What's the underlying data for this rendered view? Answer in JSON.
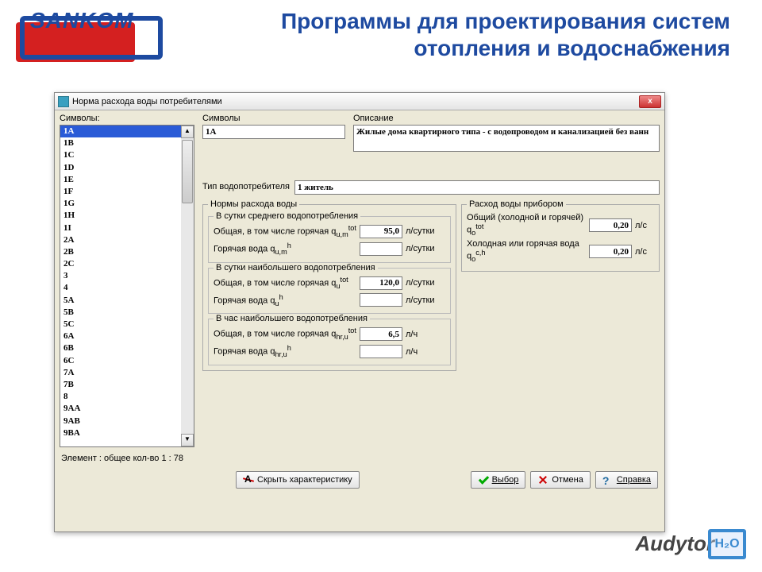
{
  "header": {
    "logo_text": "SANKOM",
    "title": "Программы для проектирования систем отопления и водоснабжения"
  },
  "dialog": {
    "title": "Норма расхода воды потребителями",
    "close": "x",
    "labels": {
      "symbols_left": "Символы:",
      "symbols_right": "Символы",
      "description": "Описание",
      "consumer_type": "Тип водопотребителя"
    },
    "list": {
      "items": [
        "1A",
        "1B",
        "1C",
        "1D",
        "1E",
        "1F",
        "1G",
        "1H",
        "1I",
        "2A",
        "2B",
        "2C",
        "3",
        "4",
        "5A",
        "5B",
        "5C",
        "6A",
        "6B",
        "6C",
        "7A",
        "7B",
        "8",
        "9AA",
        "9AB",
        "9BA"
      ],
      "selected": "1A"
    },
    "symbol_value": "1A",
    "description_value": "Жилые дома квартирного типа - с водопроводом и канализацией без ванн",
    "consumer_type_value": "1 житель",
    "group_norms": {
      "legend": "Нормы расхода воды",
      "avg": {
        "legend": "В сутки среднего водопотребления",
        "total_label": "Общая, в том числе горячая q",
        "total_sub": "u,m",
        "total_sup": "tot",
        "total_value": "95,0",
        "hot_label": "Горячая вода q",
        "hot_sub": "u,m",
        "hot_sup": "h",
        "hot_value": "",
        "unit": "л/сутки"
      },
      "max_day": {
        "legend": "В сутки наибольшего водопотребления",
        "total_label": "Общая, в том числе горячая q",
        "total_sub": "u",
        "total_sup": "tot",
        "total_value": "120,0",
        "hot_label": "Горячая вода q",
        "hot_sub": "u",
        "hot_sup": "h",
        "hot_value": "",
        "unit": "л/сутки"
      },
      "max_hour": {
        "legend": "В час наибольшего водопотребления",
        "total_label": "Общая, в том числе горячая q",
        "total_sub": "hr,u",
        "total_sup": "tot",
        "total_value": "6,5",
        "hot_label": "Горячая вода q",
        "hot_sub": "hr,u",
        "hot_sup": "h",
        "hot_value": "",
        "unit": "л/ч"
      }
    },
    "group_device": {
      "legend": "Расход воды прибором",
      "total_label": "Общий (холодной и горячей) q",
      "total_sub": "o",
      "total_sup": "tot",
      "total_value": "0,20",
      "total_unit": "л/с",
      "cold_label": "Холодная или горячая вода q",
      "cold_sub": "o",
      "cold_sup": "c,h",
      "cold_value": "0,20",
      "cold_unit": "л/с"
    },
    "status": "Элемент : общее кол-во 1 : 78",
    "buttons": {
      "hide": "Скрыть характеристику",
      "choose": "Выбор",
      "cancel": "Отмена",
      "help": "Справка"
    }
  },
  "watermark": "Audytor"
}
